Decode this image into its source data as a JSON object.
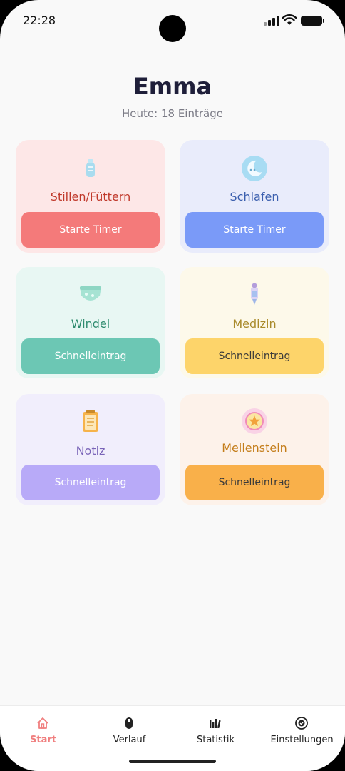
{
  "status_bar": {
    "time": "22:28"
  },
  "header": {
    "name": "Emma",
    "subtitle": "Heute: 18 Einträge"
  },
  "cards": [
    {
      "title": "Stillen/Füttern",
      "button": "Starte Timer",
      "icon": "baby-bottle-icon",
      "title_color": "#c0392b",
      "bg": "#fde7e7",
      "btn_color": "#f47a7a",
      "btn_text_color": "#ffffff"
    },
    {
      "title": "Schlafen",
      "button": "Starte Timer",
      "icon": "moon-icon",
      "title_color": "#3b5fae",
      "bg": "#e9ecfb",
      "btn_color": "#7a9af8",
      "btn_text_color": "#ffffff"
    },
    {
      "title": "Windel",
      "button": "Schnelleintrag",
      "icon": "diaper-icon",
      "title_color": "#2e8b6e",
      "bg": "#e8f7f3",
      "btn_color": "#6cc7b4",
      "btn_text_color": "#ffffff"
    },
    {
      "title": "Medizin",
      "button": "Schnelleintrag",
      "icon": "medicine-dropper-icon",
      "title_color": "#a98a2a",
      "bg": "#fdf9ea",
      "btn_color": "#fdd46a",
      "btn_text_color": "#3a3a3a"
    },
    {
      "title": "Notiz",
      "button": "Schnelleintrag",
      "icon": "notepad-icon",
      "title_color": "#7a64b8",
      "bg": "#f1eefc",
      "btn_color": "#b8aaf8",
      "btn_text_color": "#ffffff"
    },
    {
      "title": "Meilenstein",
      "button": "Schnelleintrag",
      "icon": "star-badge-icon",
      "title_color": "#c47d1a",
      "bg": "#fdf2ea",
      "btn_color": "#f9b04a",
      "btn_text_color": "#3a3a3a"
    }
  ],
  "tabs": [
    {
      "label": "Start",
      "icon": "home-icon",
      "active": true
    },
    {
      "label": "Verlauf",
      "icon": "history-icon",
      "active": false
    },
    {
      "label": "Statistik",
      "icon": "statistics-icon",
      "active": false
    },
    {
      "label": "Einstellungen",
      "icon": "settings-icon",
      "active": false
    }
  ],
  "colors": {
    "accent": "#f07f7f",
    "background": "#f9f9f9"
  }
}
